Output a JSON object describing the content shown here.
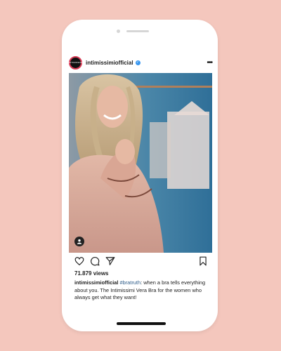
{
  "post": {
    "username": "intimissimiofficial",
    "avatar_text": "INTIMISSIMI",
    "views": "71.879 views",
    "caption_user": "intimissimiofficial",
    "caption_hashtag": "#bratruth",
    "caption_text": ": when a bra tells everything about you. The Intimissimi Vera Bra for the women who always get what they want!"
  },
  "icons": [
    "heart-icon",
    "comment-icon",
    "share-icon",
    "bookmark-icon",
    "more-icon",
    "verified-icon",
    "user-tag-icon"
  ],
  "colors": {
    "background": "#f4c7bd",
    "verified": "#3897f0",
    "hashtag": "#2f5d8a",
    "avatar_ring": "#d83b56"
  }
}
